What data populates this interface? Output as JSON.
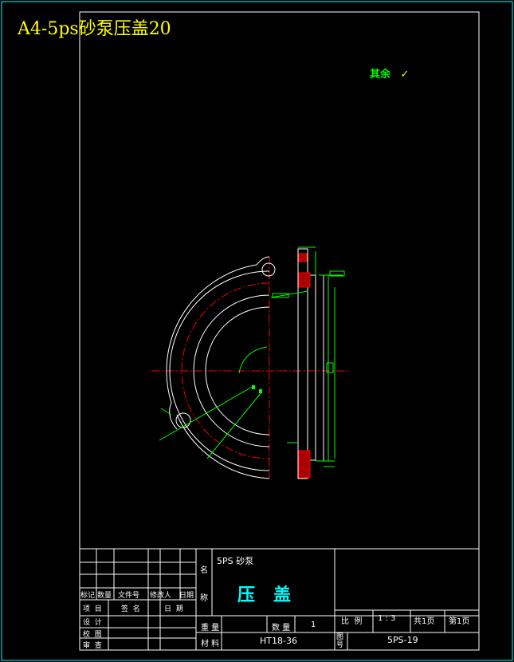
{
  "title": "A4-5ps砂泵压盖20",
  "roughness_note": "其余",
  "roughness_symbol": "✓",
  "title_block": {
    "product": "5PS  砂泵",
    "part_name": "压   盖",
    "name_label": "名",
    "name_label2": "称",
    "rev_headers": [
      "标记",
      "数量",
      "文件号",
      "修改人",
      "日期"
    ],
    "sign_rows": [
      "项  目",
      "签  名",
      "日  期"
    ],
    "roles": [
      "设  计",
      "校  图",
      "审  查"
    ],
    "weight_label": "重 量",
    "qty_label": "数 量",
    "qty_value": "1",
    "material_label": "材 料",
    "material_value": "HT18-36",
    "scale_label": "比  例",
    "scale_value": "1 : 3",
    "pages_total": "共1页",
    "page_no": "第1页",
    "drawing_no_label": "图\n号",
    "drawing_no": "5PS-19"
  },
  "colors": {
    "frame": "#00ffff",
    "sheet": "#ffffff",
    "centerline": "#ff0000",
    "dimension": "#00ff00",
    "hatch": "#ff0000",
    "title": "#ffff00"
  }
}
